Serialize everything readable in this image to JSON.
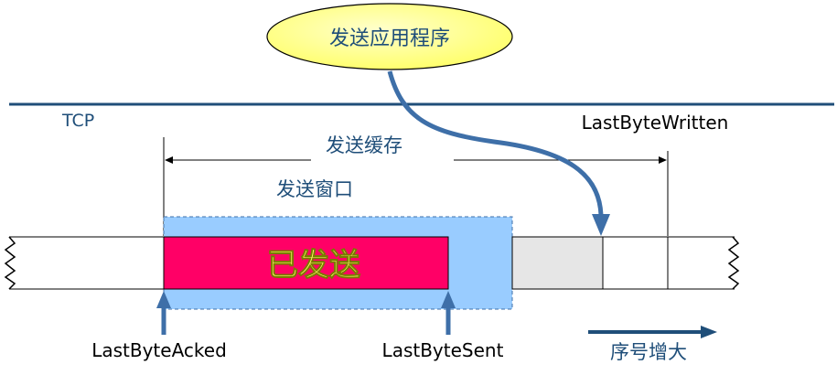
{
  "app_bubble": {
    "label": "发送应用程序"
  },
  "tcp_label": "TCP",
  "buffer": {
    "label": "发送缓存",
    "last_byte_written_label": "LastByteWritten"
  },
  "window": {
    "label": "发送窗口"
  },
  "sent_block": {
    "label": "已发送"
  },
  "pointers": {
    "last_byte_acked": "LastByteAcked",
    "last_byte_sent": "LastByteSent"
  },
  "sequence": {
    "label": "序号增大"
  },
  "colors": {
    "line_dark": "#1f4e79",
    "arrow_blue": "#3e6fa8",
    "bubble_fill": "#ffff99",
    "window_fill": "#99ccff",
    "sent_fill": "#ff0066",
    "sent_text": "#ffff66",
    "gray_fill": "#e6e6e6"
  }
}
